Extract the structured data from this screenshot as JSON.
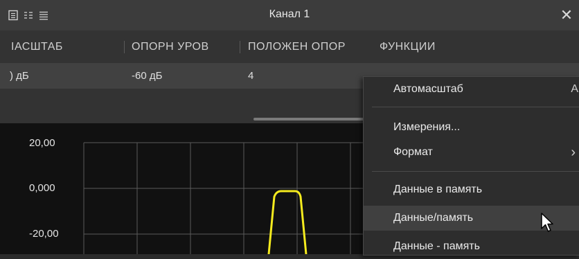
{
  "window": {
    "title": "Канал 1",
    "toolbar_icons": [
      "list-box-icon",
      "columns-icon",
      "lines-icon"
    ],
    "close_glyph": "✕"
  },
  "table": {
    "headers": [
      "ІАСШТАБ",
      "ОПОРН УРОВ",
      "ПОЛОЖЕН ОПОР",
      "ФУНКЦИИ"
    ],
    "values": [
      ") дБ",
      "-60 дБ",
      "4"
    ]
  },
  "plot": {
    "y_ticks": [
      "20,00",
      "0,000",
      "-20,00"
    ],
    "trace_color": "#f5eb1e"
  },
  "menu": {
    "items": [
      {
        "label": "Автомасштаб",
        "shortcut": "A"
      },
      {
        "label": "Измерения..."
      },
      {
        "label": "Формат",
        "submenu": "›"
      },
      {
        "label": "Данные в память"
      },
      {
        "label": "Данные/память"
      },
      {
        "label": "Данные - память"
      }
    ]
  }
}
